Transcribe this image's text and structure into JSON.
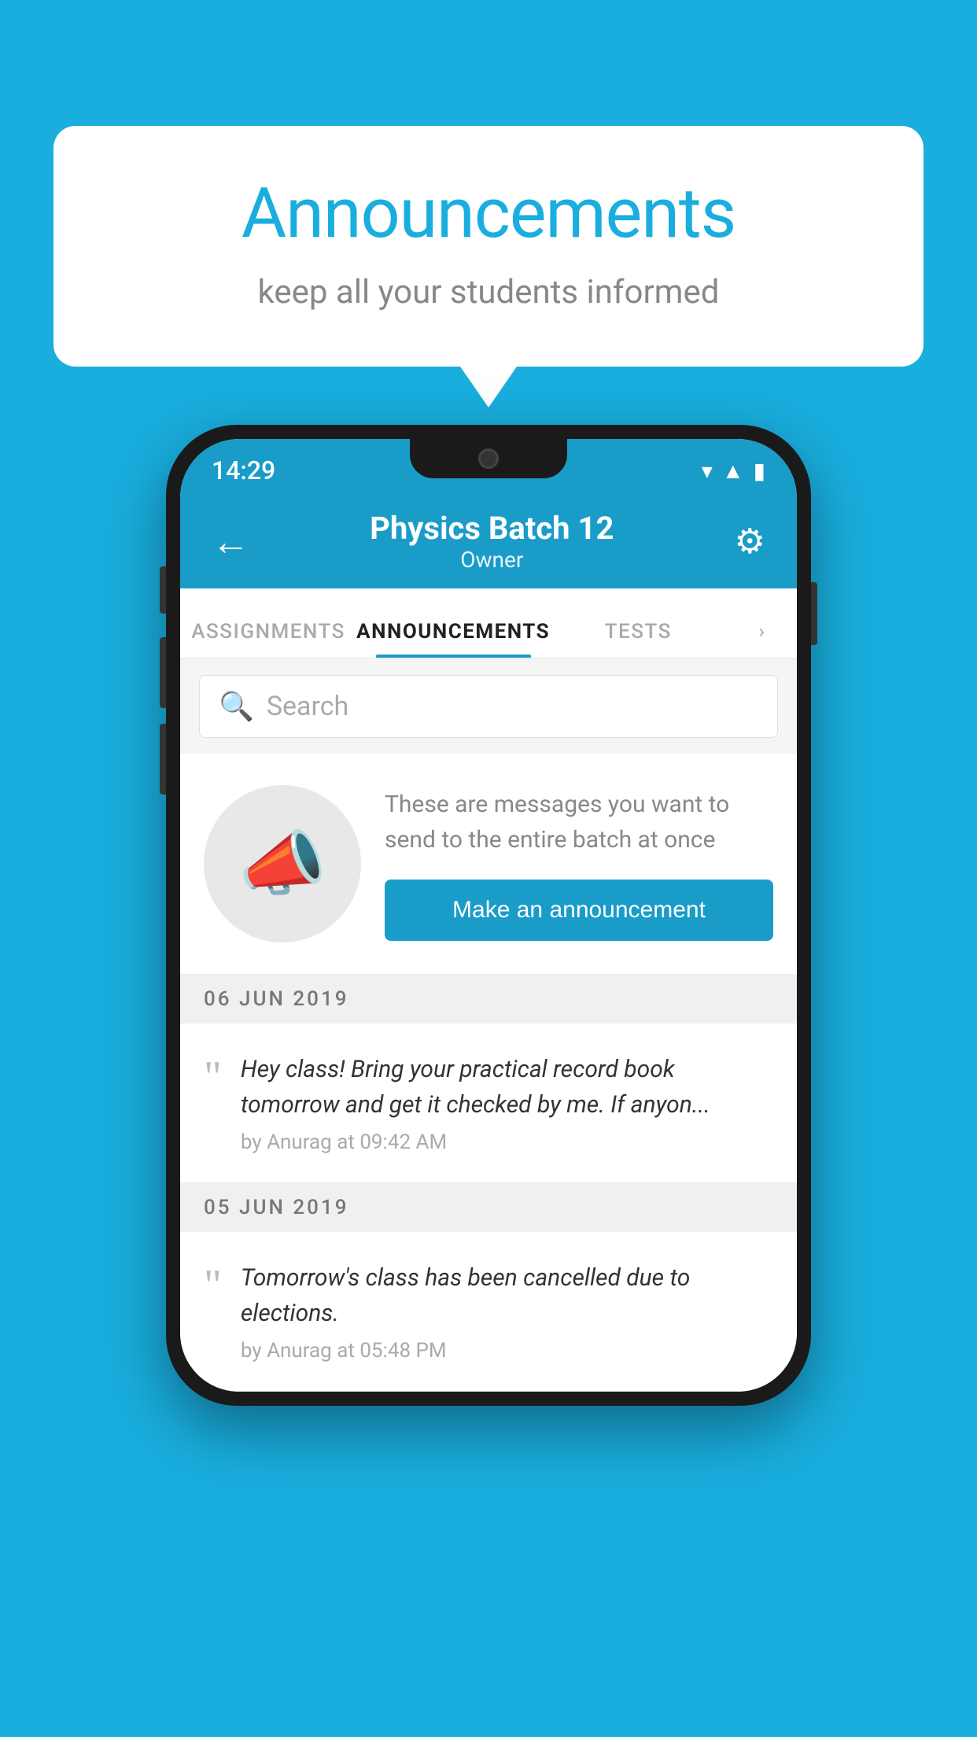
{
  "background": {
    "color": "#19AEDE"
  },
  "speech_bubble": {
    "title": "Announcements",
    "subtitle": "keep all your students informed"
  },
  "phone": {
    "status_bar": {
      "time": "14:29"
    },
    "top_bar": {
      "title": "Physics Batch 12",
      "subtitle": "Owner",
      "back_label": "←",
      "settings_label": "⚙"
    },
    "tabs": [
      {
        "label": "ASSIGNMENTS",
        "active": false
      },
      {
        "label": "ANNOUNCEMENTS",
        "active": true
      },
      {
        "label": "TESTS",
        "active": false
      }
    ],
    "search": {
      "placeholder": "Search"
    },
    "announcement_prompt": {
      "description": "These are messages you want to send to the entire batch at once",
      "button_label": "Make an announcement"
    },
    "announcements": [
      {
        "date": "06  JUN  2019",
        "message": "Hey class! Bring your practical record book tomorrow and get it checked by me. If anyon...",
        "meta": "by Anurag at 09:42 AM"
      },
      {
        "date": "05  JUN  2019",
        "message": "Tomorrow's class has been cancelled due to elections.",
        "meta": "by Anurag at 05:48 PM"
      }
    ]
  }
}
